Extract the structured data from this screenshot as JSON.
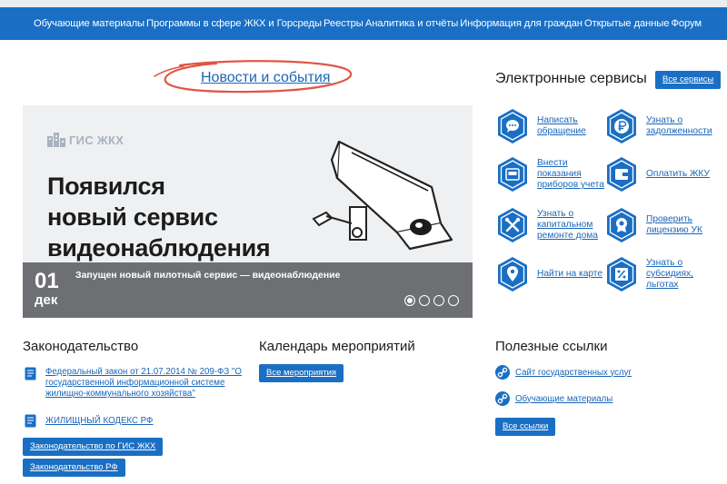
{
  "nav": {
    "items": [
      "Обучающие материалы",
      "Программы в сфере ЖКХ и Горсреды",
      "Реестры",
      "Аналитика и отчёты",
      "Информация для граждан",
      "Открытые данные",
      "Форум"
    ]
  },
  "news": {
    "title": "Новости и события"
  },
  "banner": {
    "logo_text": "ГИС ЖКХ",
    "heading_line1": "Появился",
    "heading_line2": "новый сервис",
    "heading_line3": "видеонаблюдения",
    "date_day": "01",
    "date_month": "дек",
    "caption": "Запущен новый пилотный сервис — видеонаблюдение",
    "slides_total": 4,
    "slide_active": 1
  },
  "services": {
    "title": "Электронные сервисы",
    "all_button": "Все сервисы",
    "items": [
      {
        "icon": "chat-icon",
        "l1": "Написать",
        "l2": "обращение",
        "l3": ""
      },
      {
        "icon": "ruble-icon",
        "l1": "Узнать о",
        "l2": "задолженности",
        "l3": ""
      },
      {
        "icon": "meter-icon",
        "l1": "Внести",
        "l2": "показания",
        "l3": "приборов учета"
      },
      {
        "icon": "wallet-icon",
        "l1": "Оплатить ЖКУ",
        "l2": "",
        "l3": ""
      },
      {
        "icon": "tools-icon",
        "l1": "Узнать о",
        "l2": "капитальном",
        "l3": "ремонте дома"
      },
      {
        "icon": "license-icon",
        "l1": "Проверить",
        "l2": "лицензию УК",
        "l3": ""
      },
      {
        "icon": "map-pin-icon",
        "l1": "Найти на карте",
        "l2": "",
        "l3": ""
      },
      {
        "icon": "percent-icon",
        "l1": "Узнать о",
        "l2": "субсидиях,",
        "l3": "льготах"
      }
    ]
  },
  "law": {
    "title": "Законодательство",
    "items": [
      {
        "l1": "Федеральный закон от 21.07.2014 № 209-ФЗ \"О",
        "l2": "государственной информационной системе",
        "l3": "жилищно-коммунального хозяйства\""
      },
      {
        "l1": "ЖИЛИЩНЫЙ КОДЕКС РФ",
        "l2": "",
        "l3": ""
      }
    ],
    "btn_gis": "Законодательство по ГИС ЖКХ",
    "btn_rf": "Законодательство РФ"
  },
  "calendar": {
    "title": "Календарь мероприятий",
    "btn": "Все мероприятия"
  },
  "links": {
    "title": "Полезные ссылки",
    "items": [
      "Сайт государственных услуг",
      "Обучающие материалы"
    ],
    "btn": "Все ссылки"
  },
  "colors": {
    "brand": "#1a6fc4",
    "link": "#1a66b8",
    "highlight": "#e05545"
  }
}
